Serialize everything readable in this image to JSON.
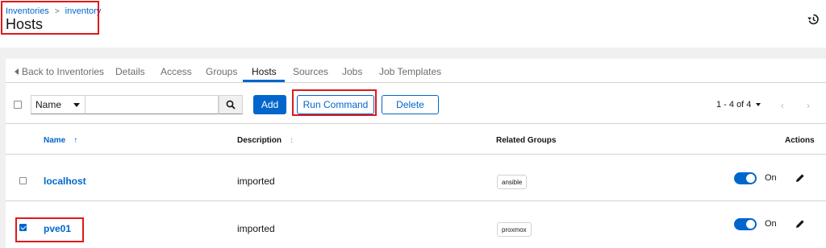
{
  "breadcrumb": {
    "root": "Inventories",
    "separator": ">",
    "current": "inventory"
  },
  "page_title": "Hosts",
  "icons": {
    "history": "history-icon",
    "search": "search-icon",
    "edit": "pencil-icon",
    "back": "caret-left-icon"
  },
  "tabs": [
    {
      "label": "Back to Inventories"
    },
    {
      "label": "Details"
    },
    {
      "label": "Access"
    },
    {
      "label": "Groups"
    },
    {
      "label": "Hosts",
      "active": true
    },
    {
      "label": "Sources"
    },
    {
      "label": "Jobs"
    },
    {
      "label": "Job Templates"
    }
  ],
  "toolbar": {
    "filter_select": "Name",
    "search_value": "",
    "add_label": "Add",
    "run_command_label": "Run Command",
    "delete_label": "Delete",
    "pagination": "1 - 4 of 4"
  },
  "table": {
    "headers": {
      "name": "Name",
      "description": "Description",
      "related_groups": "Related Groups",
      "actions": "Actions"
    },
    "rows": [
      {
        "name": "localhost",
        "description": "imported",
        "group": "ansible",
        "enabled_label": "On",
        "enabled": true,
        "selected": false
      },
      {
        "name": "pve01",
        "description": "imported",
        "group": "proxmox",
        "enabled_label": "On",
        "enabled": true,
        "selected": true
      }
    ]
  },
  "colors": {
    "accent": "#0066cc",
    "highlight": "#e0191b",
    "background": "#f0f0f0"
  }
}
